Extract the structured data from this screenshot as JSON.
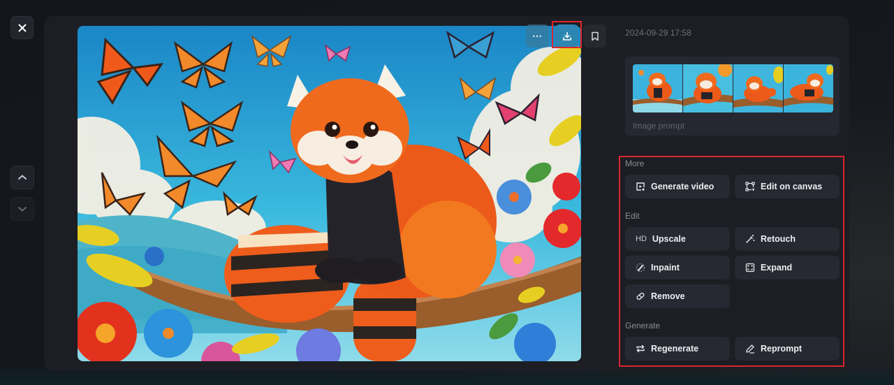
{
  "viewer": {
    "close_label": "Close",
    "nav_prev_label": "Previous",
    "nav_next_label": "Next"
  },
  "image": {
    "alt": "Cartoon red panda sitting on a tree branch surrounded by butterflies and flowers",
    "toolbar": {
      "more_label": "⋯",
      "download_label": "Download",
      "bookmark_label": "Bookmark"
    }
  },
  "details": {
    "timestamp": "2024-09-29 17:58",
    "prompt_card": {
      "label": "Image prompt",
      "thumbnail_count": 4
    }
  },
  "actions": {
    "sections": [
      {
        "title": "More",
        "buttons": [
          {
            "label": "Generate video",
            "icon": "video-frame-icon"
          },
          {
            "label": "Edit on canvas",
            "icon": "canvas-icon"
          }
        ]
      },
      {
        "title": "Edit",
        "buttons": [
          {
            "label": "Upscale",
            "icon": "hd-icon",
            "icon_text": "HD"
          },
          {
            "label": "Retouch",
            "icon": "magic-wand-icon"
          },
          {
            "label": "Inpaint",
            "icon": "brush-icon"
          },
          {
            "label": "Expand",
            "icon": "expand-icon"
          },
          {
            "label": "Remove",
            "icon": "eraser-icon"
          }
        ]
      },
      {
        "title": "Generate",
        "buttons": [
          {
            "label": "Regenerate",
            "icon": "repeat-icon"
          },
          {
            "label": "Reprompt",
            "icon": "pencil-icon"
          }
        ]
      }
    ]
  },
  "colors": {
    "highlight": "#d8262c",
    "download_accent": "#2c86b1",
    "panel_bg": "#1c1e24",
    "button_bg": "#262931"
  }
}
